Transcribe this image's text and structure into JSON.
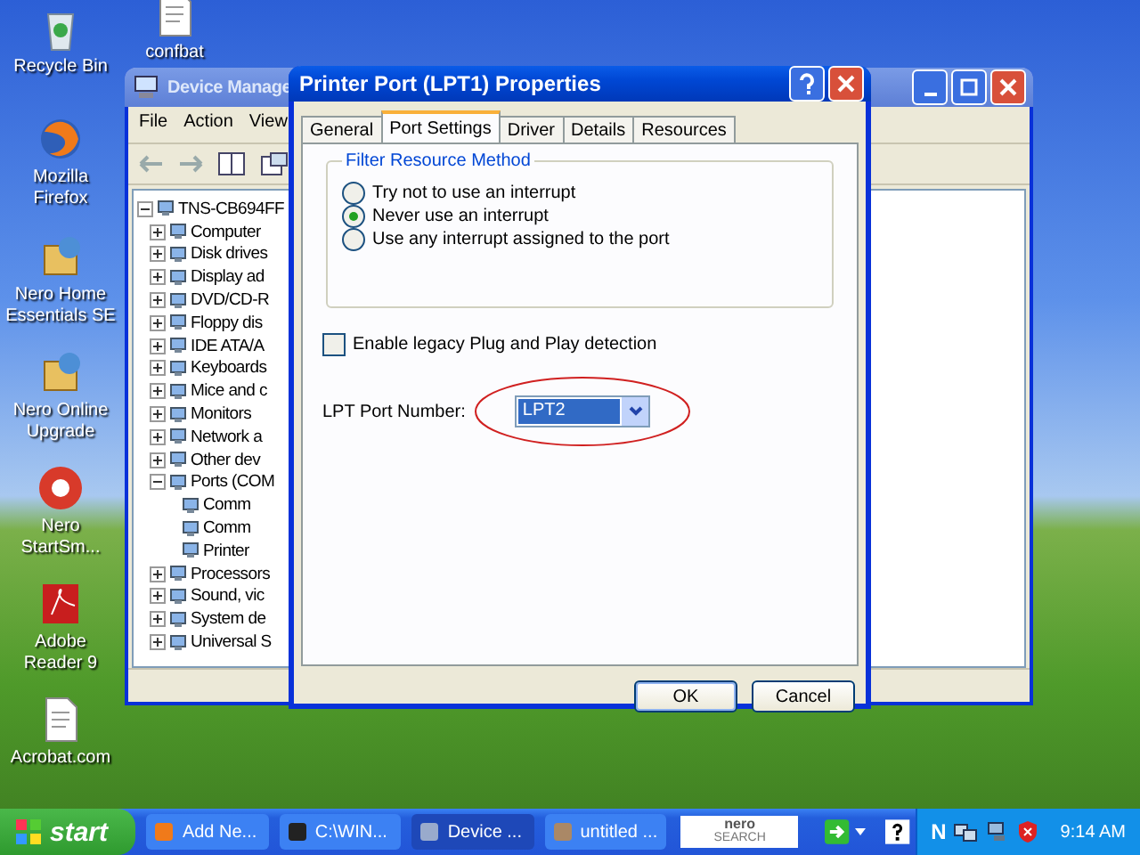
{
  "desktop_icons": [
    {
      "label": "Recycle Bin"
    },
    {
      "label": "confbat"
    },
    {
      "label": "Mozilla Firefox"
    },
    {
      "label": "Nero Home Essentials SE"
    },
    {
      "label": "Nero Online Upgrade"
    },
    {
      "label": "Nero StartSm..."
    },
    {
      "label": "Adobe Reader 9"
    },
    {
      "label": "Acrobat.com"
    }
  ],
  "device_manager": {
    "title": "Device Manage",
    "menu": [
      "File",
      "Action",
      "View"
    ],
    "tree": {
      "label": "TNS-CB694FF",
      "expanded": true,
      "children": [
        {
          "label": "Computer",
          "expanded": false
        },
        {
          "label": "Disk drives",
          "expanded": false
        },
        {
          "label": "Display ad",
          "expanded": false
        },
        {
          "label": "DVD/CD-R",
          "expanded": false
        },
        {
          "label": "Floppy dis",
          "expanded": false
        },
        {
          "label": "IDE ATA/A",
          "expanded": false
        },
        {
          "label": "Keyboards",
          "expanded": false
        },
        {
          "label": "Mice and c",
          "expanded": false
        },
        {
          "label": "Monitors",
          "expanded": false
        },
        {
          "label": "Network a",
          "expanded": false
        },
        {
          "label": "Other dev",
          "expanded": false
        },
        {
          "label": "Ports (COM",
          "expanded": true,
          "children": [
            {
              "label": "Comm"
            },
            {
              "label": "Comm"
            },
            {
              "label": "Printer"
            }
          ]
        },
        {
          "label": "Processors",
          "expanded": false
        },
        {
          "label": "Sound, vic",
          "expanded": false
        },
        {
          "label": "System de",
          "expanded": false
        },
        {
          "label": "Universal S",
          "expanded": false
        }
      ]
    }
  },
  "dialog": {
    "title": "Printer Port (LPT1) Properties",
    "tabs": [
      {
        "label": "General",
        "selected": false
      },
      {
        "label": "Port Settings",
        "selected": true
      },
      {
        "label": "Driver",
        "selected": false
      },
      {
        "label": "Details",
        "selected": false
      },
      {
        "label": "Resources",
        "selected": false
      }
    ],
    "group": "Filter Resource Method",
    "radios": [
      {
        "label": "Try not to use an interrupt",
        "selected": false
      },
      {
        "label": "Never use an interrupt",
        "selected": true
      },
      {
        "label": "Use any interrupt assigned to the port",
        "selected": false
      }
    ],
    "legacy_checkbox": {
      "label": "Enable legacy Plug and Play detection",
      "checked": false
    },
    "port_number": {
      "label": "LPT Port Number:",
      "value": "LPT2"
    },
    "buttons": [
      "OK",
      "Cancel"
    ]
  },
  "taskbar": {
    "start": "start",
    "tasks": [
      {
        "label": "Add Ne...",
        "selected": false
      },
      {
        "label": "C:\\WIN...",
        "selected": false
      },
      {
        "label": "Device ...",
        "selected": true
      },
      {
        "label": "untitled ...",
        "selected": false
      }
    ],
    "search_logo": [
      "nero",
      "SEARCH"
    ],
    "tray_letter": "N",
    "clock": "9:14 AM"
  }
}
